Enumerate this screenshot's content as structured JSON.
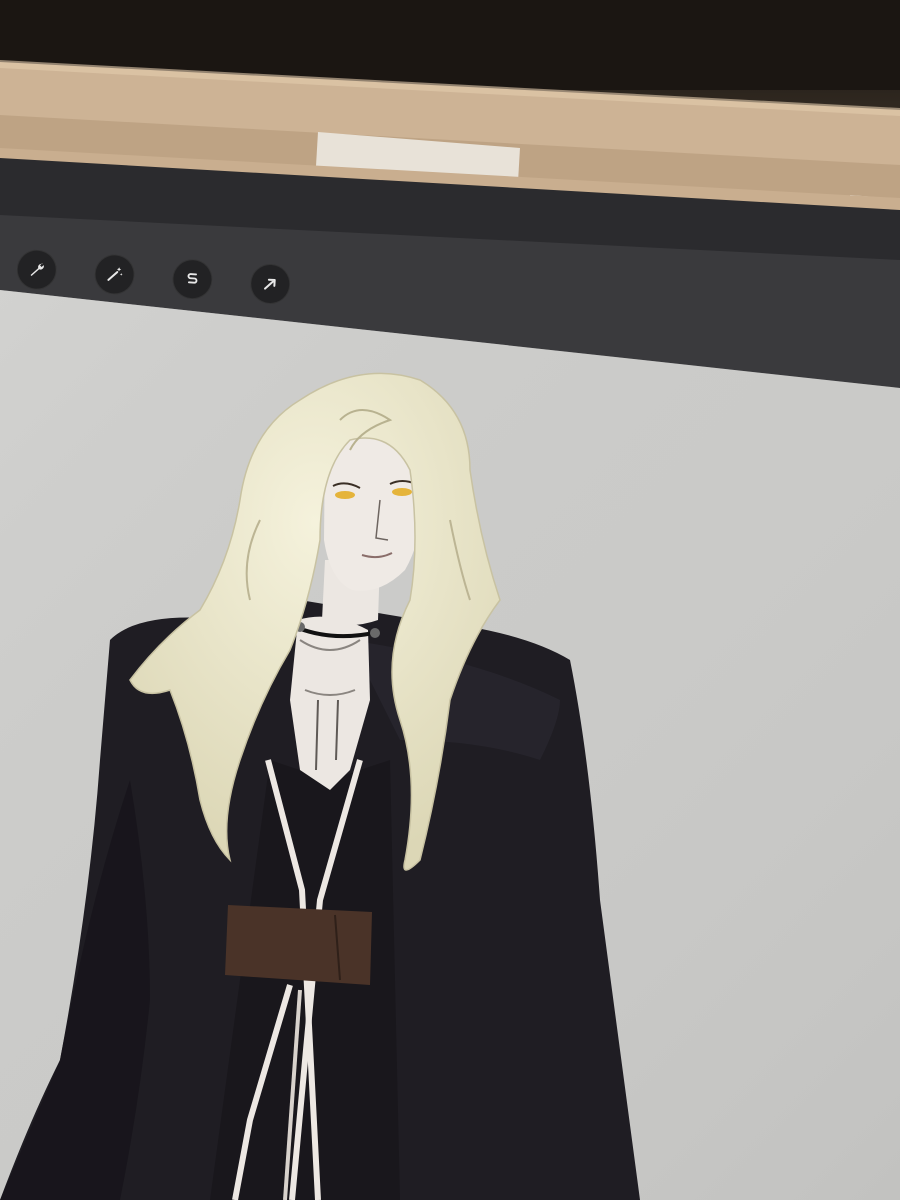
{
  "app": {
    "toolbar": {
      "tools": [
        {
          "name": "actions",
          "icon": "wrench-icon",
          "tooltip": ""
        },
        {
          "name": "adjustments",
          "icon": "magic-wand-icon",
          "tooltip": ""
        },
        {
          "name": "selection",
          "icon": "selection-s-icon",
          "tooltip": ""
        },
        {
          "name": "transform",
          "icon": "arrow-cursor-icon",
          "tooltip": ""
        }
      ]
    },
    "canvas": {
      "background_color": "#cfcfcd",
      "artwork_subject": "long-haired figure in black cloak"
    },
    "colors": {
      "cloak": "#1e1c22",
      "hair": "#e9e6c8",
      "skin": "#ece7e2",
      "belt": "#4a3328",
      "eyes": "#e5b43a"
    }
  }
}
